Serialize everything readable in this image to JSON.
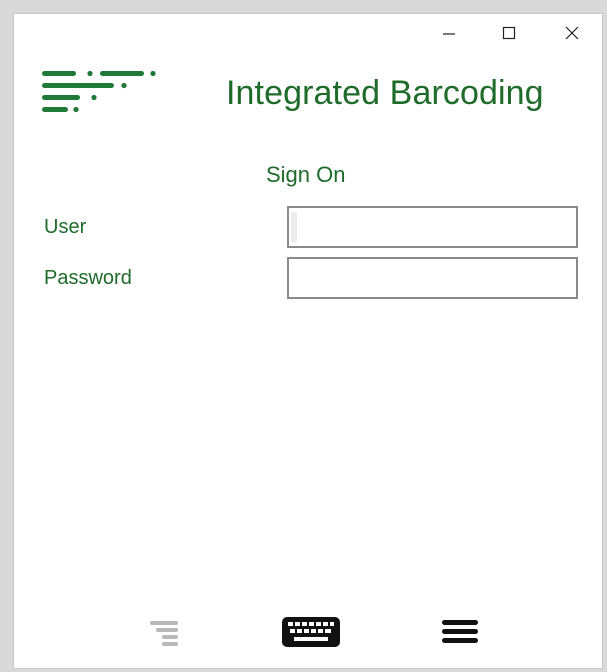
{
  "window": {
    "controls": {
      "minimize_icon": "minimize-icon",
      "maximize_icon": "maximize-icon",
      "close_icon": "close-icon"
    }
  },
  "header": {
    "logo_icon": "speed-lines-logo",
    "title": "Integrated Barcoding"
  },
  "form": {
    "heading": "Sign On",
    "user_label": "User",
    "user_value": "",
    "password_label": "Password",
    "password_value": ""
  },
  "toolbar": {
    "items": [
      {
        "icon": "list-lines-icon",
        "state": "disabled"
      },
      {
        "icon": "keyboard-icon",
        "state": "enabled"
      },
      {
        "icon": "hamburger-menu-icon",
        "state": "enabled"
      }
    ]
  },
  "colors": {
    "brand_green": "#1e6b2a",
    "logo_green": "#1f7a38",
    "input_border": "#8a8a8a",
    "disabled_icon": "#b8b8b8",
    "icon_dark": "#111111"
  }
}
